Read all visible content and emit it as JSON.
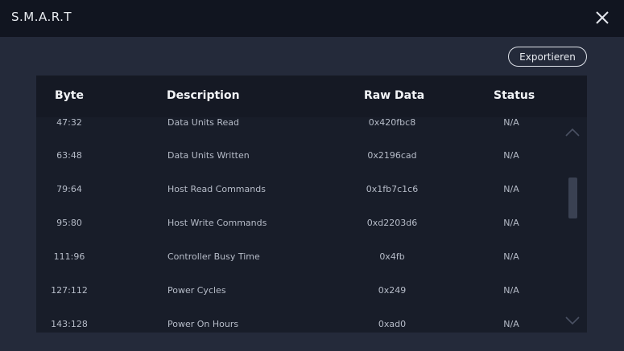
{
  "window": {
    "title": "S.M.A.R.T",
    "close_icon": "close-icon"
  },
  "toolbar": {
    "export_label": "Exportieren"
  },
  "table": {
    "headers": [
      "Byte",
      "Description",
      "Raw Data",
      "Status"
    ],
    "rows": [
      {
        "byte": "47:32",
        "description": "Data Units Read",
        "raw": "0x420fbc8",
        "status": "N/A"
      },
      {
        "byte": "63:48",
        "description": "Data Units Written",
        "raw": "0x2196cad",
        "status": "N/A"
      },
      {
        "byte": "79:64",
        "description": "Host Read Commands",
        "raw": "0x1fb7c1c6",
        "status": "N/A"
      },
      {
        "byte": "95:80",
        "description": "Host Write Commands",
        "raw": "0xd2203d6",
        "status": "N/A"
      },
      {
        "byte": "111:96",
        "description": "Controller Busy Time",
        "raw": "0x4fb",
        "status": "N/A"
      },
      {
        "byte": "127:112",
        "description": "Power Cycles",
        "raw": "0x249",
        "status": "N/A"
      },
      {
        "byte": "143:128",
        "description": "Power On Hours",
        "raw": "0xad0",
        "status": "N/A"
      }
    ]
  },
  "scrollbar": {
    "up_icon": "chevron-up-icon",
    "down_icon": "chevron-down-icon"
  },
  "colors": {
    "background": "#242a3a",
    "titlebar": "#111520",
    "table_bg": "#181d29",
    "text": "#b6bcc8"
  }
}
